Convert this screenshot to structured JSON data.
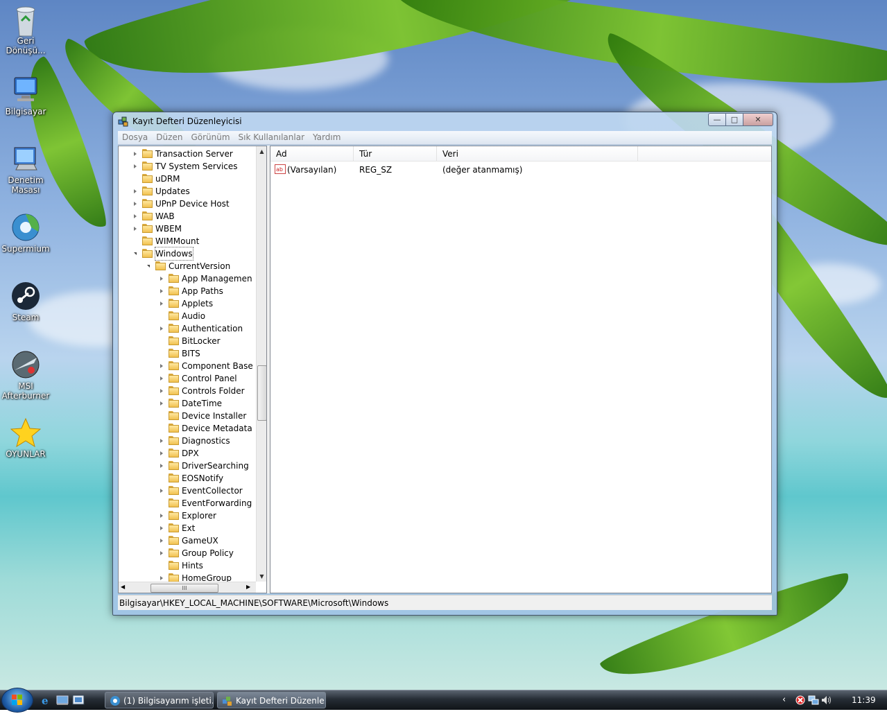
{
  "desktop": {
    "icons": [
      {
        "label": "Geri Dönüşü...",
        "icon": "recycle-bin-icon"
      },
      {
        "label": "Bilgisayar",
        "icon": "computer-icon"
      },
      {
        "label": "Denetim Masası",
        "icon": "control-panel-icon"
      },
      {
        "label": "Supermium",
        "icon": "browser-icon"
      },
      {
        "label": "Steam",
        "icon": "steam-icon"
      },
      {
        "label": "MSI Afterburner",
        "icon": "afterburner-icon"
      },
      {
        "label": "OYUNLAR",
        "icon": "star-folder-icon"
      }
    ]
  },
  "window": {
    "title": "Kayıt Defteri Düzenleyicisi",
    "controls": {
      "minimize": "—",
      "maximize": "□",
      "close": "✕"
    },
    "menu": [
      "Dosya",
      "Düzen",
      "Görünüm",
      "Sık Kullanılanlar",
      "Yardım"
    ],
    "tree": {
      "nodes": [
        {
          "label": "Transaction Server",
          "expandable": true
        },
        {
          "label": "TV System Services",
          "expandable": true
        },
        {
          "label": "uDRM",
          "expandable": false
        },
        {
          "label": "Updates",
          "expandable": true
        },
        {
          "label": "UPnP Device Host",
          "expandable": true
        },
        {
          "label": "WAB",
          "expandable": true
        },
        {
          "label": "WBEM",
          "expandable": true
        },
        {
          "label": "WIMMount",
          "expandable": false
        },
        {
          "label": "Windows",
          "expandable": true,
          "expanded": true,
          "selected": true
        },
        {
          "label": "CurrentVersion",
          "expandable": true,
          "expanded": true
        },
        {
          "label": "App Managemen",
          "expandable": true
        },
        {
          "label": "App Paths",
          "expandable": true
        },
        {
          "label": "Applets",
          "expandable": true
        },
        {
          "label": "Audio",
          "expandable": false
        },
        {
          "label": "Authentication",
          "expandable": true
        },
        {
          "label": "BitLocker",
          "expandable": false
        },
        {
          "label": "BITS",
          "expandable": false
        },
        {
          "label": "Component Base",
          "expandable": true
        },
        {
          "label": "Control Panel",
          "expandable": true
        },
        {
          "label": "Controls Folder",
          "expandable": true
        },
        {
          "label": "DateTime",
          "expandable": true
        },
        {
          "label": "Device Installer",
          "expandable": false
        },
        {
          "label": "Device Metadata",
          "expandable": false
        },
        {
          "label": "Diagnostics",
          "expandable": true
        },
        {
          "label": "DPX",
          "expandable": true
        },
        {
          "label": "DriverSearching",
          "expandable": true
        },
        {
          "label": "EOSNotify",
          "expandable": false
        },
        {
          "label": "EventCollector",
          "expandable": true
        },
        {
          "label": "EventForwarding",
          "expandable": false
        },
        {
          "label": "Explorer",
          "expandable": true
        },
        {
          "label": "Ext",
          "expandable": true
        },
        {
          "label": "GameUX",
          "expandable": true
        },
        {
          "label": "Group Policy",
          "expandable": true
        },
        {
          "label": "Hints",
          "expandable": false
        },
        {
          "label": "HomeGroup",
          "expandable": true
        }
      ],
      "hscroll_grip": "III"
    },
    "list": {
      "columns": [
        "Ad",
        "Tür",
        "Veri"
      ],
      "rows": [
        {
          "name": "(Varsayılan)",
          "type": "REG_SZ",
          "data": "(değer atanmamış)",
          "icon": "string-value-icon"
        }
      ]
    },
    "status": "Bilgisayar\\HKEY_LOCAL_MACHINE\\SOFTWARE\\Microsoft\\Windows"
  },
  "taskbar": {
    "tasks": [
      {
        "label": "(1) Bilgisayarım işleti...",
        "icon": "browser-icon"
      },
      {
        "label": "Kayıt Defteri Düzenle...",
        "icon": "regedit-icon"
      }
    ],
    "tray": {
      "chevron": "‹",
      "clock": "11:39"
    }
  },
  "colors": {
    "accent": "#1f5da8",
    "titlebar": "#b7d1ee",
    "selection_outline": "#666666"
  }
}
